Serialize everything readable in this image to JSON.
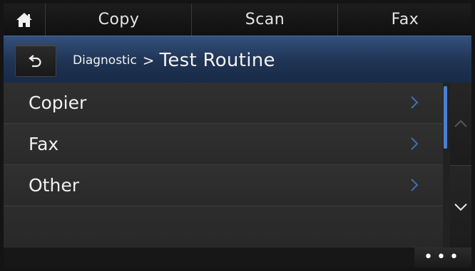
{
  "tabs": {
    "copy": "Copy",
    "scan": "Scan",
    "fax": "Fax"
  },
  "header": {
    "breadcrumb_parent": "Diagnostic",
    "breadcrumb_separator": ">",
    "title": "Test Routine"
  },
  "list": {
    "items": [
      {
        "label": "Copier",
        "icon": "chevron-right-icon"
      },
      {
        "label": "Fax",
        "icon": "chevron-right-icon"
      },
      {
        "label": "Other",
        "icon": "chevron-right-icon"
      }
    ]
  },
  "icons": {
    "home": "home-icon",
    "back": "back-arrow-icon",
    "scroll_up": "chevron-up-icon",
    "scroll_down": "chevron-down-icon",
    "more": "more-icon"
  },
  "footer": {
    "more_label": "•••"
  },
  "colors": {
    "accent": "#4a7fd0",
    "titlebar": "#2a4268",
    "list_bg": "#2b2b2b",
    "text": "#f0f0f0"
  }
}
